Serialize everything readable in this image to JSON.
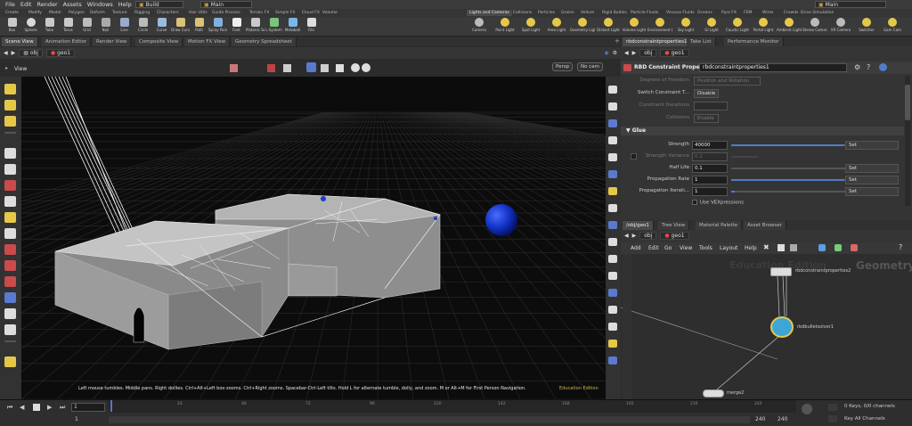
{
  "menubar": {
    "items": [
      "File",
      "Edit",
      "Render",
      "Assets",
      "Windows",
      "Help"
    ],
    "build_desktop": "Build",
    "main_desktop": "Main",
    "right_desktop": "Main"
  },
  "shelf_tabs": [
    "Create",
    "Modify",
    "Model",
    "Polygon",
    "Deform",
    "Texture",
    "Rigging",
    "Characters",
    "Hair Utils",
    "Guide Process",
    "Terrain FX",
    "Simple FX",
    "Cloud FX",
    "Volume",
    "Lights and Cameras",
    "Collisions",
    "Particles",
    "Grains",
    "Vellum",
    "Rigid Bodies",
    "Particle Fluids",
    "Viscous Fluids",
    "Oceans",
    "Pyro FX",
    "FEM",
    "Wires",
    "Crowds",
    "Drive Simulation"
  ],
  "shelf_tools_left": [
    "Box",
    "Sphere",
    "Tube",
    "Torus",
    "Grid",
    "Null",
    "Line",
    "Circle",
    "Curve",
    "Draw Curve",
    "Path",
    "Spray Paint",
    "Font",
    "Platonic Solids",
    "L-System",
    "Metaball",
    "File"
  ],
  "shelf_tools_right": [
    "Camera",
    "Point Light",
    "Spot Light",
    "Area Light",
    "Geometry Light",
    "Distant Light",
    "Volume Light",
    "Environment Light",
    "Sky Light",
    "GI Light",
    "Caustic Light",
    "Portal Light",
    "Ambient Light",
    "Stereo Camera",
    "VR Camera",
    "Switcher",
    "Gam Cam"
  ],
  "pane_tabs_left": [
    "Scene View",
    "Animation Editor",
    "Render View",
    "Composite View",
    "Motion FX View",
    "Geometry Spreadsheet"
  ],
  "pane_tabs_right": [
    "rbdconstraintproperties1",
    "Take List",
    "Performance Monitor"
  ],
  "path": {
    "obj": "obj",
    "geo": "geo1"
  },
  "viewport": {
    "title": "View",
    "persp_menu": "Persp",
    "cam_menu": "No cam",
    "status_hint": "Left mouse tumbles. Middle pans. Right dollies. Ctrl+Alt+Left box-zooms. Ctrl+Right zooms. Spacebar-Ctrl-Left tilts. Hold L for alternate tumble, dolly, and zoom.     M or Alt+M for First Person Navigation.",
    "edition": "Education Edition"
  },
  "parms": {
    "node_type": "RBD Constraint Properties",
    "node_name": "rbdconstraintproperties1",
    "rows_top": [
      {
        "label": "Degrees of Freedom",
        "value": "Position and Rotation",
        "disabled": true
      },
      {
        "label": "Switch Constraint T...",
        "value": "Disable",
        "disabled": false
      },
      {
        "label": "Constraint Iterations",
        "value": "",
        "disabled": true
      },
      {
        "label": "Collisions",
        "value": "Enable",
        "disabled": true
      }
    ],
    "glue_header": "Glue",
    "glue_rows": [
      {
        "label": "Strength",
        "value": "40000",
        "button": "Set",
        "disabled": false,
        "fill": 0.98
      },
      {
        "label": "Strength Variance",
        "value": "0.2",
        "button": "",
        "disabled": true,
        "fill": 0
      },
      {
        "label": "Half Life",
        "value": "0.1",
        "button": "Set",
        "disabled": false,
        "fill": 0
      },
      {
        "label": "Propagation Rate",
        "value": "1",
        "button": "Set",
        "disabled": false,
        "fill": 0.98
      },
      {
        "label": "Propagation Iterati...",
        "value": "1",
        "button": "Set",
        "disabled": false,
        "fill": 0.03
      }
    ],
    "vex_label": "Use VEXpressions"
  },
  "network": {
    "tabs": [
      "/obj/geo1",
      "Tree View",
      "Material Palette",
      "Asset Browser"
    ],
    "menu": [
      "Add",
      "Edit",
      "Go",
      "View",
      "Tools",
      "Layout",
      "Help"
    ],
    "watermark_left": "Education Edition",
    "watermark_right": "Geometry",
    "nodes": [
      {
        "name": "rbdconstraintproperties2"
      },
      {
        "name": "rbdbulletsolver1"
      },
      {
        "name": "merge2"
      }
    ]
  },
  "timeline": {
    "frame": "1",
    "start": "1",
    "end_a": "240",
    "end_b": "240",
    "ticks": [
      "24",
      "48",
      "72",
      "96",
      "120",
      "142",
      "168",
      "192",
      "216",
      "240"
    ],
    "keys": "0 Keys, 0/0 channels",
    "key_all": "Key All Channels"
  },
  "colors": {
    "accent": "#4f7cc7",
    "sphere": "#1233c4",
    "edition": "#d6b44a"
  }
}
